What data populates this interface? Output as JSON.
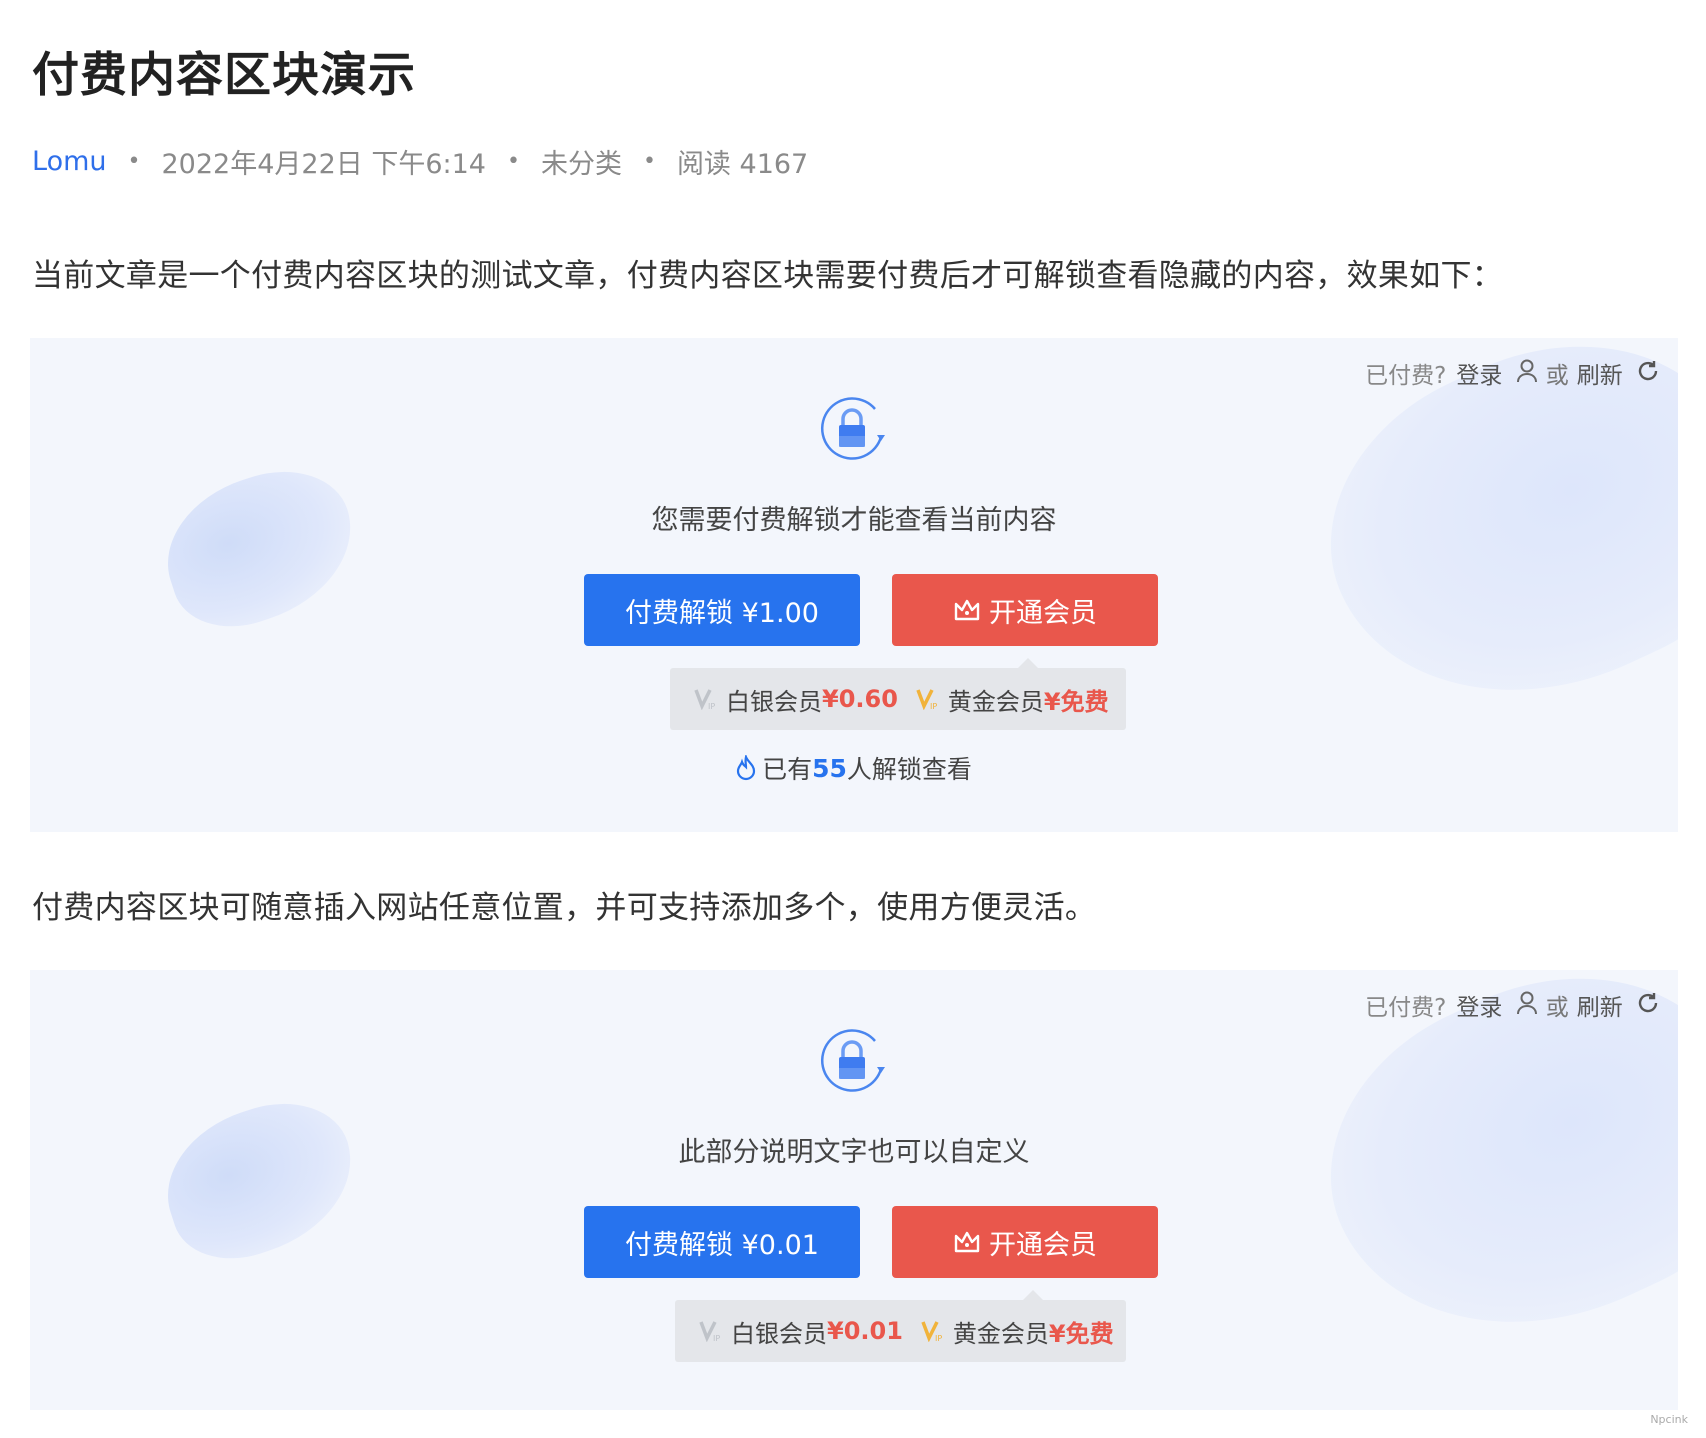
{
  "post": {
    "title": "付费内容区块演示",
    "author": "Lomu",
    "date": "2022年4月22日 下午6:14",
    "category": "未分类",
    "views": "阅读 4167",
    "intro": "当前文章是一个付费内容区块的测试文章，付费内容区块需要付费后才可解锁查看隐藏的内容，效果如下：",
    "middle_text": "付费内容区块可随意插入网站任意位置，并可支持添加多个，使用方便灵活。"
  },
  "paywall_common": {
    "paid_prompt": "已付费?",
    "login": "登录",
    "or": "或",
    "refresh": "刷新",
    "vip_button": "开通会员",
    "silver_label": "白银会员",
    "gold_label": "黄金会员",
    "gold_price": "¥免费"
  },
  "paywalls": [
    {
      "tip": "您需要付费解锁才能查看当前内容",
      "pay_button": "付费解锁 ¥1.00",
      "silver_price": "¥0.60",
      "unlock_prefix": "已有",
      "unlock_count": "55",
      "unlock_suffix": "人解锁查看"
    },
    {
      "tip": "此部分说明文字也可以自定义",
      "pay_button": "付费解锁 ¥0.01",
      "silver_price": "¥0.01"
    }
  ],
  "colors": {
    "primary": "#2773ee",
    "danger": "#e9574c",
    "panel_bg": "#f3f6fc"
  },
  "watermark": "Npcink"
}
